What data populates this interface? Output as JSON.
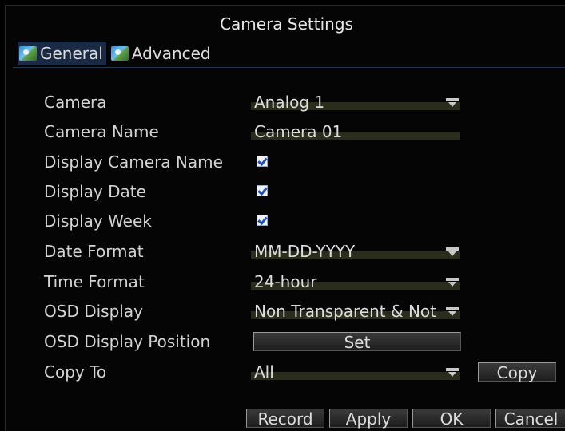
{
  "window": {
    "title": "Camera Settings"
  },
  "tabs": [
    {
      "label": "General",
      "icon": "camera-tab-icon",
      "active": true
    },
    {
      "label": "Advanced",
      "icon": "camera-tab-icon",
      "active": false
    }
  ],
  "fields": {
    "camera": {
      "label": "Camera",
      "value": "Analog 1"
    },
    "camera_name": {
      "label": "Camera Name",
      "value": "Camera 01"
    },
    "display_camera_name": {
      "label": "Display Camera Name",
      "checked": true
    },
    "display_date": {
      "label": "Display Date",
      "checked": true
    },
    "display_week": {
      "label": "Display Week",
      "checked": true
    },
    "date_format": {
      "label": "Date Format",
      "value": "MM-DD-YYYY"
    },
    "time_format": {
      "label": "Time Format",
      "value": "24-hour"
    },
    "osd_display": {
      "label": "OSD Display",
      "value": "Non Transparent & Not"
    },
    "osd_display_position": {
      "label": "OSD Display Position",
      "button": "Set"
    },
    "copy_to": {
      "label": "Copy To",
      "value": "All",
      "button": "Copy"
    }
  },
  "footer": {
    "record": "Record",
    "apply": "Apply",
    "ok": "OK",
    "cancel": "Cancel"
  },
  "colors": {
    "tab_active": "#1b2a44",
    "checkbox_mark": "#1f4fb8",
    "field_bar": "#2a2c1c"
  }
}
